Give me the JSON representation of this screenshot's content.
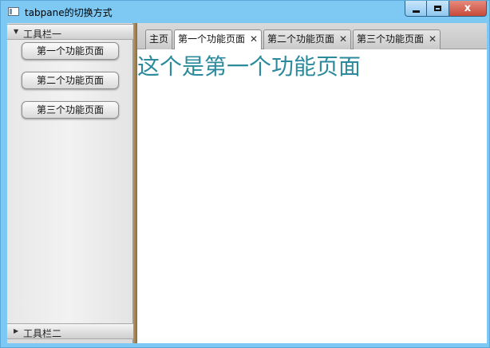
{
  "window": {
    "title": "tabpane的切换方式",
    "close_glyph": "x",
    "colors": {
      "frame": "#7ec8f4",
      "close": "#c74a3a",
      "content_text": "#2b8a9b"
    }
  },
  "accordion": {
    "panes": [
      {
        "title": "工具栏一",
        "expanded": true,
        "arrow": "▼",
        "buttons": [
          "第一个功能页面",
          "第二个功能页面",
          "第三个功能页面"
        ]
      },
      {
        "title": "工具栏二",
        "expanded": false,
        "arrow": "▶"
      }
    ]
  },
  "tabs": {
    "items": [
      {
        "label": "主页",
        "closable": false
      },
      {
        "label": "第一个功能页面",
        "closable": true,
        "selected": true
      },
      {
        "label": "第二个功能页面",
        "closable": true
      },
      {
        "label": "第三个功能页面",
        "closable": true
      }
    ],
    "close_glyph": "✕"
  },
  "content": {
    "text": "这个是第一个功能页面"
  }
}
